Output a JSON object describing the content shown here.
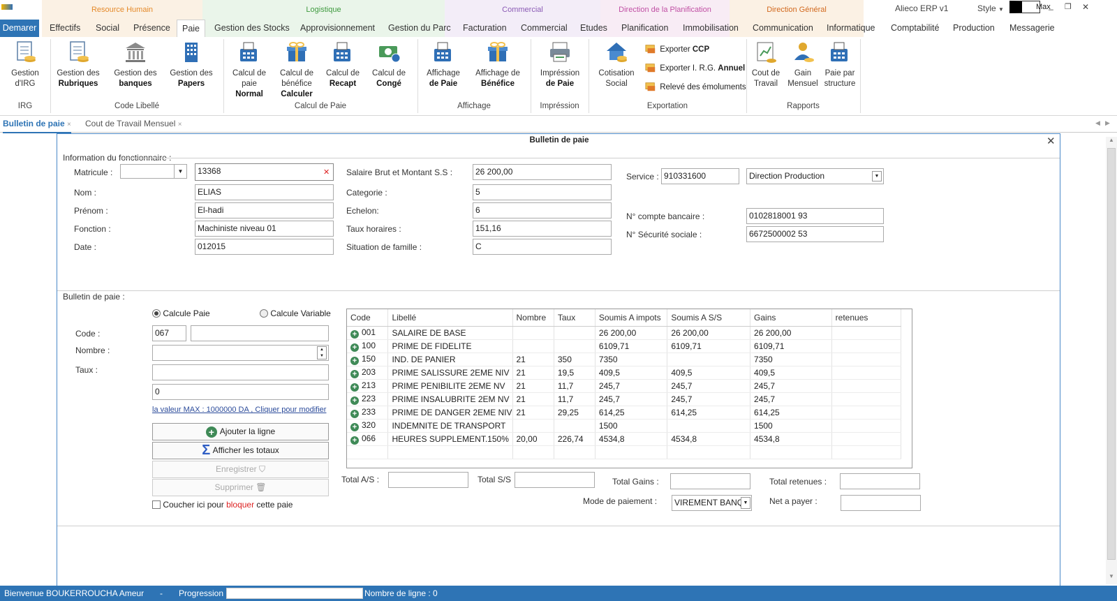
{
  "window": {
    "title": "Alieco ERP v1",
    "style_label": "Style",
    "max_label": "Max",
    "minimize": "_",
    "restore": "❐",
    "close": "✕"
  },
  "categories": [
    {
      "label": "Resource Humain",
      "color": "#e58a2a",
      "bg": "#fbf1e4"
    },
    {
      "label": "Logistique",
      "color": "#3f9a3f",
      "bg": "#eaf5ea"
    },
    {
      "label": "Commercial",
      "color": "#8b5bb5",
      "bg": "#f3edf8"
    },
    {
      "label": "Direction de la Planification",
      "color": "#c04fa4",
      "bg": "#f8ecf5"
    },
    {
      "label": "Direction Général",
      "color": "#d2691e",
      "bg": "#fbf1e4"
    }
  ],
  "tabs": [
    "Demarer",
    "Effectifs",
    "Social",
    "Présence",
    "Paie",
    "Gestion des Stocks",
    "Approvisionnement",
    "Gestion du Parc",
    "Facturation",
    "Commercial",
    "Etudes",
    "Planification",
    "Immobilisation",
    "Communication",
    "Informatique",
    "Comptabilité",
    "Production",
    "Messagerie"
  ],
  "ribbon": {
    "buttons": [
      {
        "l1": "Gestion",
        "l2": "d'IRG",
        "l3": ""
      },
      {
        "l1": "Gestion des",
        "l2": "Rubriques",
        "l3": ""
      },
      {
        "l1": "Gestion des",
        "l2": "banques",
        "l3": ""
      },
      {
        "l1": "Gestion des",
        "l2": "Papers",
        "l3": ""
      },
      {
        "l1": "Calcul de",
        "l2": "paie",
        "l3": "Normal"
      },
      {
        "l1": "Calcul de",
        "l2": "bénéfice",
        "l3": "Calculer"
      },
      {
        "l1": "Calcul de",
        "l2": "Recapt",
        "l3": ""
      },
      {
        "l1": "Calcul de",
        "l2": "Congé",
        "l3": ""
      },
      {
        "l1": "Affichage",
        "l2": "de Paie",
        "l3": ""
      },
      {
        "l1": "Affichage de",
        "l2": "Bénéfice",
        "l3": ""
      },
      {
        "l1": "Impréssion",
        "l2": "de Paie",
        "l3": ""
      },
      {
        "l1": "Cotisation",
        "l2": "Social",
        "l3": ""
      },
      {
        "l1": "Cout de",
        "l2": "Travail",
        "l3": ""
      },
      {
        "l1": "Gain",
        "l2": "Mensuel",
        "l3": ""
      },
      {
        "l1": "Paie par",
        "l2": "structure",
        "l3": ""
      }
    ],
    "export_items": [
      {
        "pre": "Exporter ",
        "bold": "CCP"
      },
      {
        "pre": "Exporter I. R.G. ",
        "bold": "Annuel"
      },
      {
        "pre": "Relevé des émoluments",
        "bold": ""
      }
    ],
    "groups": [
      "IRG",
      "Code Libellé",
      "Calcul de Paie",
      "Affichage",
      "Impréssion",
      "Exportation",
      "Rapports"
    ]
  },
  "doc_tabs": [
    {
      "label": "Bulletin de paie",
      "active": true
    },
    {
      "label": "Cout de Travail Mensuel",
      "active": false
    }
  ],
  "panel": {
    "title": "Bulletin de paie"
  },
  "info": {
    "section": "Information du fonctionnaire :",
    "matricule_label": "Matricule :",
    "matricule": "13368",
    "nom_label": "Nom :",
    "nom": "ELIAS",
    "prenom_label": "Prénom :",
    "prenom": "El-hadi",
    "fonction_label": "Fonction :",
    "fonction": "Machiniste niveau 01",
    "date_label": "Date :",
    "date": "012015",
    "salaire_label": "Salaire Brut et Montant S.S :",
    "salaire": "26 200,00",
    "categorie_label": "Categorie :",
    "categorie": "5",
    "echelon_label": "Echelon:",
    "echelon": "6",
    "taux_label": "Taux horaires :",
    "taux": "151,16",
    "situation_label": "Situation de famille :",
    "situation": "C",
    "service_label": "Service :",
    "service_code": "910331600",
    "service_name": "Direction Production",
    "compte_label": "N° compte bancaire :",
    "compte": "0102818001 93",
    "secu_label": "N° Sécurité sociale :",
    "secu": "6672500002 53"
  },
  "bulletin": {
    "section": "Bulletin de paie :",
    "radio1": "Calcule Paie",
    "radio2": "Calcule Variable",
    "code_label": "Code :",
    "code": "067",
    "nombre_label": "Nombre :",
    "taux_label": "Taux :",
    "montant": "0",
    "max_link": "la valeur MAX : 1000000 DA , Cliquer pour modifier",
    "btn_ajouter": "Ajouter la ligne",
    "btn_totaux": "Afficher les totaux",
    "btn_enregistrer": "Enregistrer",
    "btn_supprimer": "Supprimer",
    "block_pre": "Coucher  ici pour ",
    "block_red": "bloquer",
    "block_post": " cette paie"
  },
  "grid": {
    "headers": [
      "Code",
      "Libellé",
      "Nombre",
      "Taux",
      "Soumis A impots",
      "Soumis A S/S",
      "Gains",
      "retenues"
    ],
    "rows": [
      [
        "001",
        "SALAIRE DE BASE",
        "",
        "",
        "26 200,00",
        "26 200,00",
        "26 200,00",
        ""
      ],
      [
        "100",
        "PRIME DE FIDELITE",
        "",
        "",
        "6109,71",
        "6109,71",
        "6109,71",
        ""
      ],
      [
        "150",
        "IND. DE PANIER",
        "21",
        "350",
        "7350",
        "",
        "7350",
        ""
      ],
      [
        "203",
        "PRIME SALISSURE 2EME NIV",
        "21",
        "19,5",
        "409,5",
        "409,5",
        "409,5",
        ""
      ],
      [
        "213",
        "PRIME PENIBILITE 2EME NV",
        "21",
        "11,7",
        "245,7",
        "245,7",
        "245,7",
        ""
      ],
      [
        "223",
        "PRIME INSALUBRITE 2EM NV",
        "21",
        "11,7",
        "245,7",
        "245,7",
        "245,7",
        ""
      ],
      [
        "233",
        "PRIME DE DANGER 2EME NIV",
        "21",
        "29,25",
        "614,25",
        "614,25",
        "614,25",
        ""
      ],
      [
        "320",
        "INDEMNITE DE TRANSPORT",
        "",
        "",
        "1500",
        "",
        "1500",
        ""
      ],
      [
        "066",
        "HEURES SUPPLEMENT.150%",
        "20,00",
        "226,74",
        "4534,8",
        "4534,8",
        "4534,8",
        ""
      ]
    ]
  },
  "totals": {
    "as": "Total  A/S :",
    "ss": "Total S/S",
    "gains": "Total Gains :",
    "retenues": "Total retenues :",
    "mode_label": "Mode de paiement :",
    "mode": "VIREMENT BANQU",
    "net": "Net a payer :"
  },
  "status": {
    "welcome": "Bienvenue BOUKERROUCHA Ameur",
    "dash": "-",
    "progress_label": "Progression",
    "lines": "Nombre de ligne :  0"
  }
}
